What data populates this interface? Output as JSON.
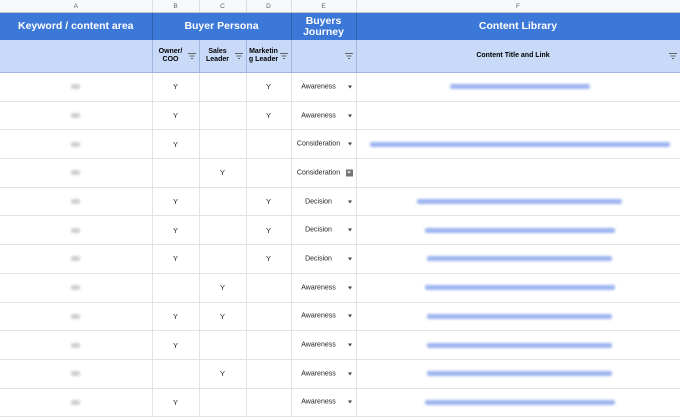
{
  "columns": {
    "letters": [
      "A",
      "B",
      "C",
      "D",
      "E",
      "F"
    ]
  },
  "band": {
    "keyword": "Keyword / content area",
    "persona": "Buyer Persona",
    "journey_line1": "Buyers",
    "journey_line2": "Journey",
    "library": "Content Library"
  },
  "headers": {
    "owner": "Owner/ COO",
    "sales": "Sales Leader",
    "marketing": "Marketin g Leader",
    "content": "Content Title and Link"
  },
  "rows": [
    {
      "owner": "Y",
      "sales": "",
      "marketing": "Y",
      "journey": "Awareness",
      "link": true
    },
    {
      "owner": "Y",
      "sales": "",
      "marketing": "Y",
      "journey": "Awareness",
      "link": false
    },
    {
      "owner": "Y",
      "sales": "",
      "marketing": "",
      "journey": "Consideration",
      "link": true
    },
    {
      "owner": "",
      "sales": "Y",
      "marketing": "",
      "journey": "Consideration",
      "link": false
    },
    {
      "owner": "Y",
      "sales": "",
      "marketing": "Y",
      "journey": "Decision",
      "link": true
    },
    {
      "owner": "Y",
      "sales": "",
      "marketing": "Y",
      "journey": "Decision",
      "link": true
    },
    {
      "owner": "Y",
      "sales": "",
      "marketing": "Y",
      "journey": "Decision",
      "link": true
    },
    {
      "owner": "",
      "sales": "Y",
      "marketing": "",
      "journey": "Awareness",
      "link": true
    },
    {
      "owner": "Y",
      "sales": "Y",
      "marketing": "",
      "journey": "Awareness",
      "link": true
    },
    {
      "owner": "Y",
      "sales": "",
      "marketing": "",
      "journey": "Awareness",
      "link": true
    },
    {
      "owner": "",
      "sales": "Y",
      "marketing": "",
      "journey": "Awareness",
      "link": true
    },
    {
      "owner": "Y",
      "sales": "",
      "marketing": "",
      "journey": "Awareness",
      "link": true
    }
  ],
  "colors": {
    "band": "#3c78d8",
    "header": "#c9daf8",
    "link": "#9db4f0"
  }
}
